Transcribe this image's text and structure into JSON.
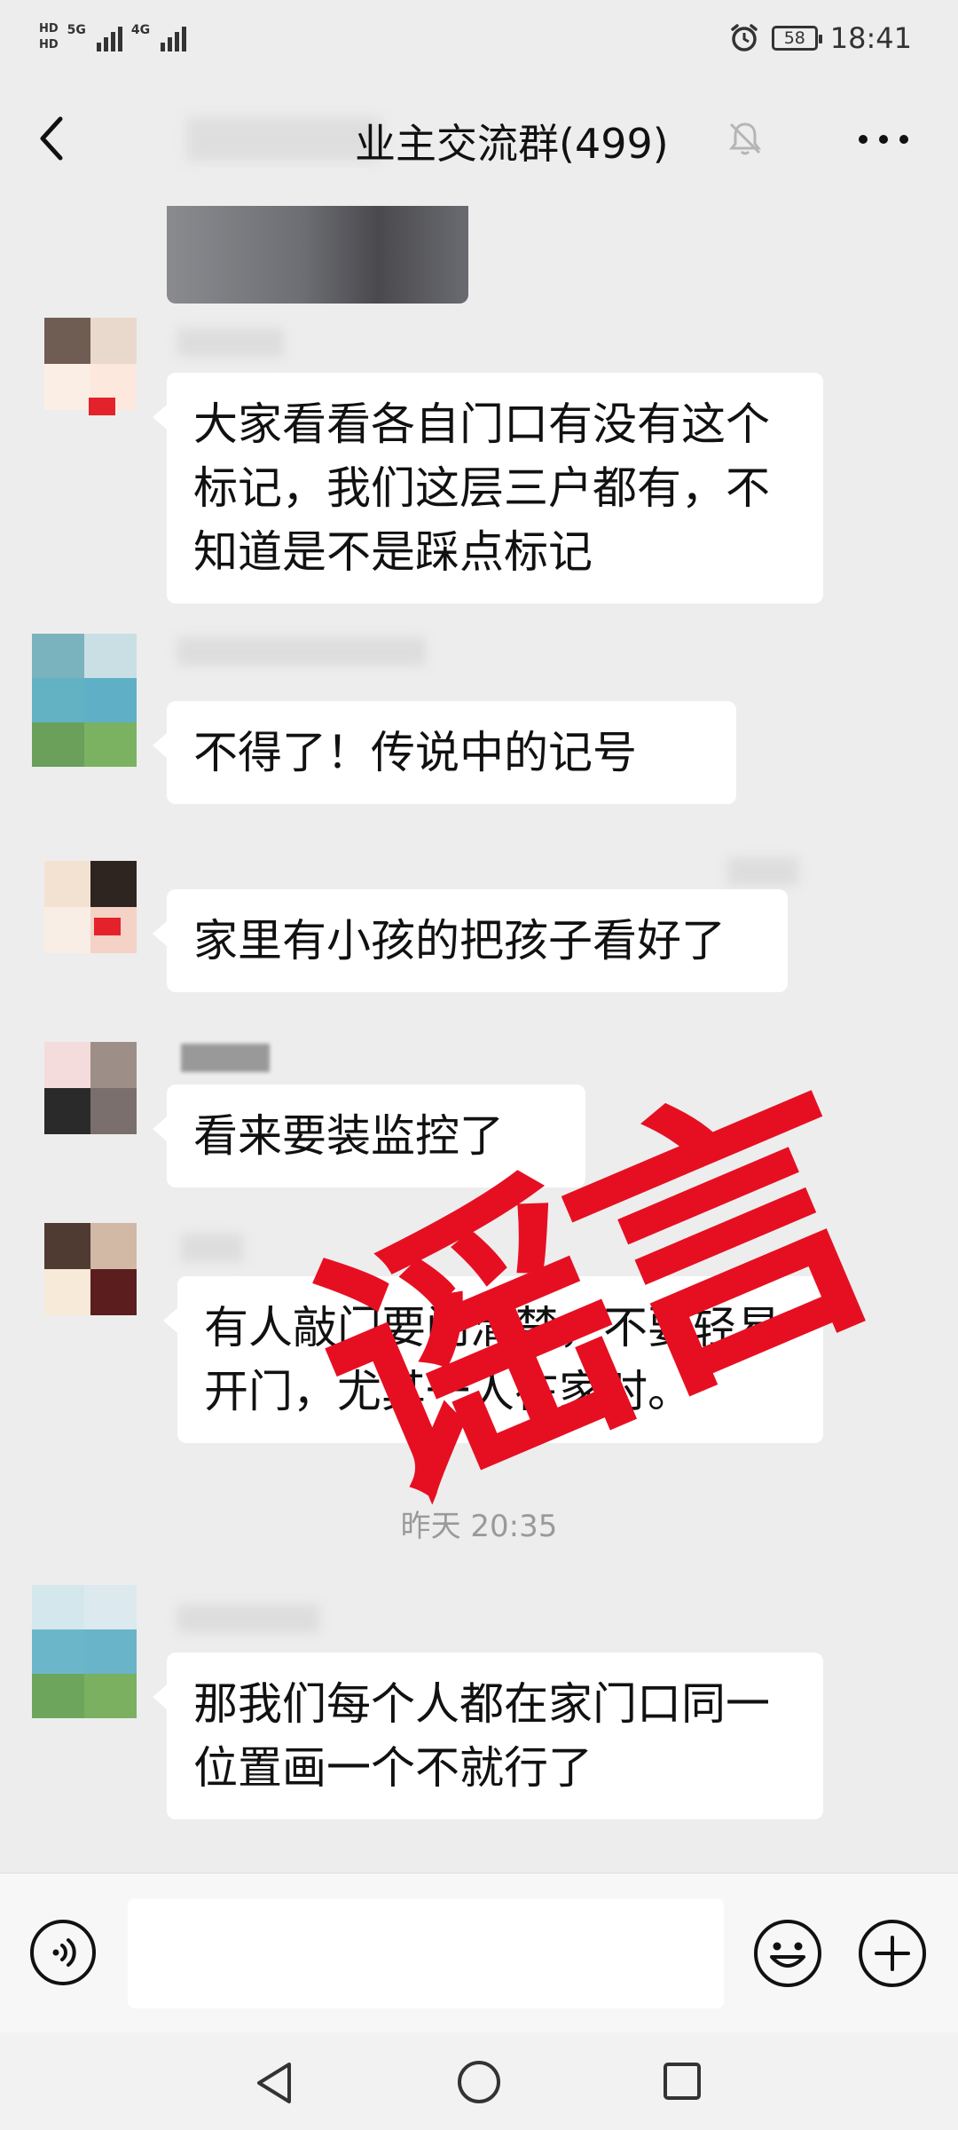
{
  "status_bar": {
    "hd_label": "HD",
    "network_1": "5G",
    "network_2": "4G",
    "battery": "58",
    "time": "18:41"
  },
  "header": {
    "title": "业主交流群(499)",
    "icons": [
      "back-arrow-icon",
      "mute-bell-icon",
      "more-dots-icon"
    ]
  },
  "messages": [
    {
      "type": "image"
    },
    {
      "type": "text",
      "text": "大家看看各自门口有没有这个标记，我们这层三户都有，不知道是不是踩点标记"
    },
    {
      "type": "text",
      "text": "不得了！传说中的记号"
    },
    {
      "type": "text",
      "text": "家里有小孩的把孩子看好了"
    },
    {
      "type": "text",
      "text": "看来要装监控了"
    },
    {
      "type": "text",
      "text": "有人敲门要问清楚，不要轻易开门，尤其一人在家时。"
    },
    {
      "type": "time",
      "text": "昨天 20:35"
    },
    {
      "type": "text",
      "text": "那我们每个人都在家门口同一位置画一个不就行了"
    }
  ],
  "stamp": {
    "text": "谣言",
    "color": "#e60f22"
  },
  "input_bar": {
    "placeholder": "",
    "icons": [
      "voice-icon",
      "emoji-icon",
      "plus-icon"
    ]
  },
  "nav_bar": {
    "icons": [
      "nav-back-icon",
      "nav-home-icon",
      "nav-recent-icon"
    ]
  },
  "colors": {
    "background": "#ededed",
    "bubble": "#ffffff",
    "stamp": "#e60f22"
  }
}
